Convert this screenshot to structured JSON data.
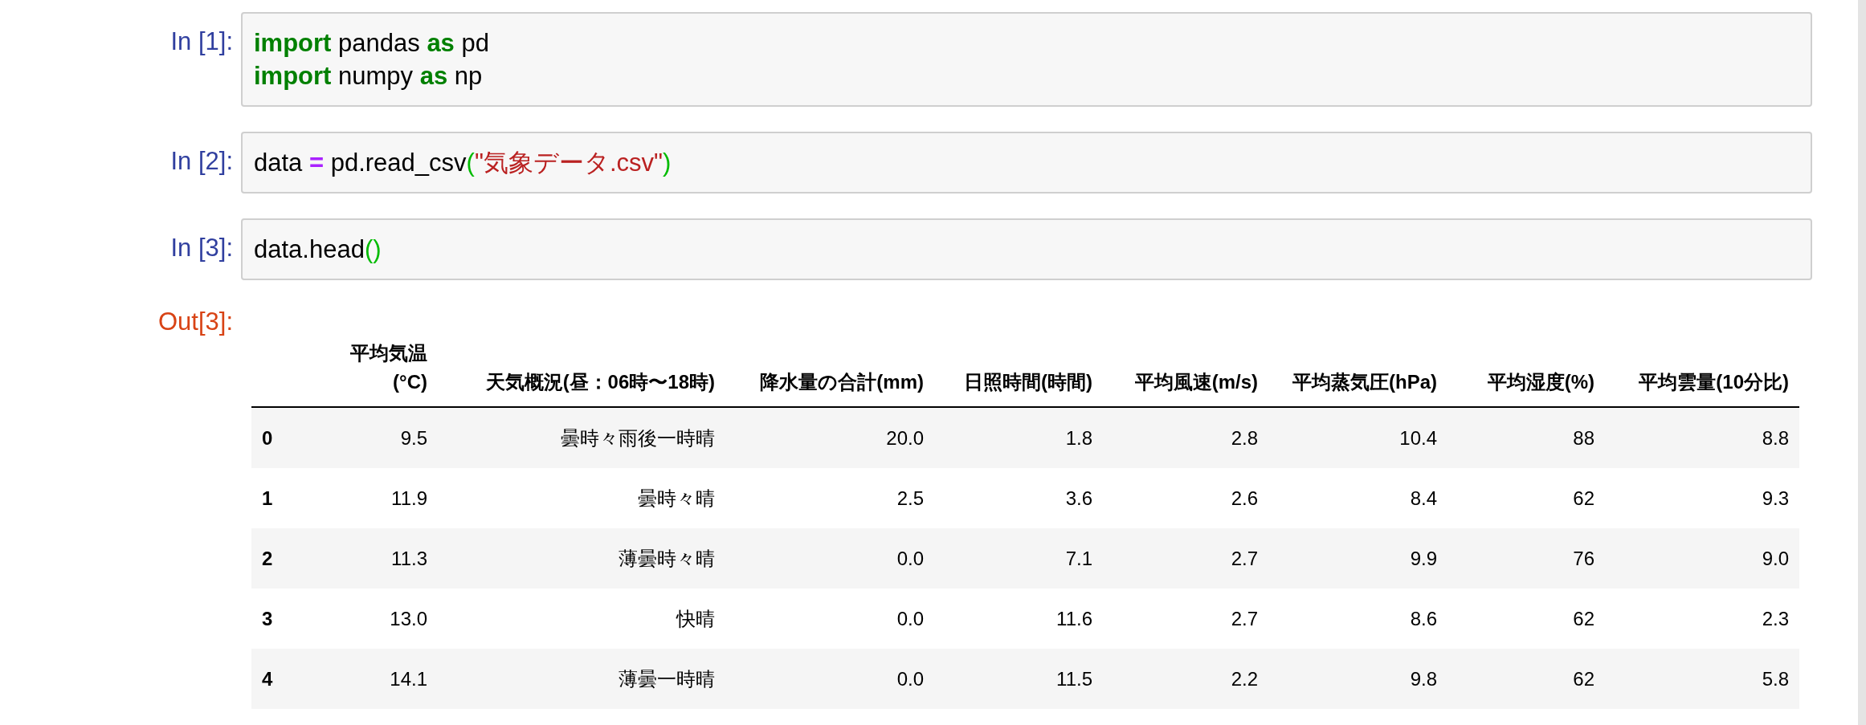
{
  "cells": [
    {
      "prompt": "In [1]:",
      "lines": [
        [
          {
            "kind": "keyword",
            "text": "import"
          },
          {
            "kind": "name",
            "text": " pandas "
          },
          {
            "kind": "keyword",
            "text": "as"
          },
          {
            "kind": "name",
            "text": " pd"
          }
        ],
        [
          {
            "kind": "keyword",
            "text": "import"
          },
          {
            "kind": "name",
            "text": " numpy "
          },
          {
            "kind": "keyword",
            "text": "as"
          },
          {
            "kind": "name",
            "text": " np"
          }
        ]
      ]
    },
    {
      "prompt": "In [2]:",
      "lines": [
        [
          {
            "kind": "name",
            "text": "data "
          },
          {
            "kind": "operator",
            "text": "="
          },
          {
            "kind": "name",
            "text": " pd.read_csv"
          },
          {
            "kind": "paren",
            "text": "("
          },
          {
            "kind": "string",
            "text": "\"気象データ.csv\""
          },
          {
            "kind": "paren",
            "text": ")"
          }
        ]
      ]
    },
    {
      "prompt": "In [3]:",
      "lines": [
        [
          {
            "kind": "name",
            "text": "data.head"
          },
          {
            "kind": "paren",
            "text": "()"
          }
        ]
      ]
    }
  ],
  "output": {
    "prompt": "Out[3]:",
    "table": {
      "columns": [
        "",
        "平均気温(°C)",
        "天気概況(昼：06時〜18時)",
        "降水量の合計(mm)",
        "日照時間(時間)",
        "平均風速(m/s)",
        "平均蒸気圧(hPa)",
        "平均湿度(%)",
        "平均雲量(10分比)"
      ],
      "rows": [
        [
          "0",
          "9.5",
          "曇時々雨後一時晴",
          "20.0",
          "1.8",
          "2.8",
          "10.4",
          "88",
          "8.8"
        ],
        [
          "1",
          "11.9",
          "曇時々晴",
          "2.5",
          "3.6",
          "2.6",
          "8.4",
          "62",
          "9.3"
        ],
        [
          "2",
          "11.3",
          "薄曇時々晴",
          "0.0",
          "7.1",
          "2.7",
          "9.9",
          "76",
          "9.0"
        ],
        [
          "3",
          "13.0",
          "快晴",
          "0.0",
          "11.6",
          "2.7",
          "8.6",
          "62",
          "2.3"
        ],
        [
          "4",
          "14.1",
          "薄曇一時晴",
          "0.0",
          "11.5",
          "2.2",
          "9.8",
          "62",
          "5.8"
        ]
      ]
    }
  }
}
